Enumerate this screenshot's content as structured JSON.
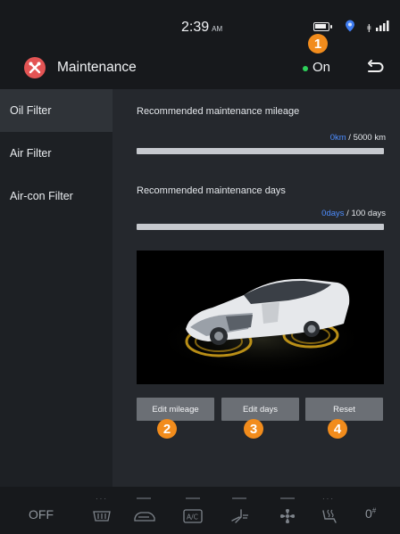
{
  "status_bar": {
    "time": "2:39",
    "ampm": "AM"
  },
  "header": {
    "title": "Maintenance",
    "status_text": "On"
  },
  "sidebar": {
    "items": [
      {
        "label": "Oil Filter",
        "active": true
      },
      {
        "label": "Air Filter",
        "active": false
      },
      {
        "label": "Air-con Filter",
        "active": false
      }
    ]
  },
  "mileage": {
    "title": "Recommended maintenance mileage",
    "current": "0km",
    "separator": "/",
    "target": "5000 km",
    "progress": 0
  },
  "days": {
    "title": "Recommended maintenance days",
    "current": "0days",
    "separator": "/",
    "target": "100 days",
    "progress": 0
  },
  "buttons": {
    "edit_mileage": "Edit mileage",
    "edit_days": "Edit days",
    "reset": "Reset"
  },
  "callouts": [
    "1",
    "2",
    "3",
    "4"
  ],
  "bottom_bar": {
    "off_label": "OFF",
    "temperature": "0",
    "temperature_unit": "#",
    "icons": [
      "rear-defrost-icon",
      "windshield-defrost-icon",
      "ac-icon",
      "seat-airflow-icon",
      "fan-icon",
      "seat-heat-icon"
    ]
  },
  "colors": {
    "accent": "#4d8dff",
    "callout": "#f28c1c",
    "status_on": "#2ed05a",
    "app_icon": "#e35454"
  }
}
